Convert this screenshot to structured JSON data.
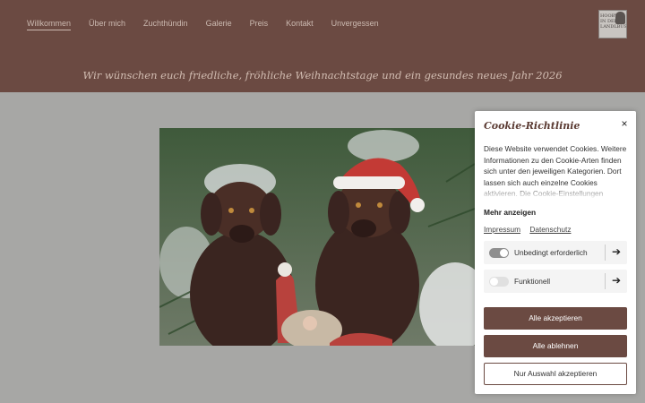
{
  "nav": {
    "items": [
      {
        "label": "Willkommen",
        "active": true
      },
      {
        "label": "Über mich"
      },
      {
        "label": "Zuchthündin"
      },
      {
        "label": "Galerie"
      },
      {
        "label": "Preis"
      },
      {
        "label": "Kontakt"
      },
      {
        "label": "Unvergessen"
      }
    ]
  },
  "logo": {
    "text": "HOOBY IN DER LANDLBUSH",
    "icon": "portrait-logo-icon"
  },
  "tagline": "Wir wünschen euch friedliche, fröhliche Weihnachtstage und ein gesundes neues Jahr 2026",
  "photo": {
    "icon": "two-labradors-christmas-photo"
  },
  "cookie": {
    "title": "Cookie-Richtlinie",
    "close": "×",
    "description": "Diese Website verwendet Cookies. Weitere Informationen zu den Cookie-Arten finden sich unter den jeweiligen Kategorien. Dort lassen sich auch einzelne Cookies aktivieren. Die Cookie-Einstellungen können",
    "more": "Mehr anzeigen",
    "links": {
      "impressum": "Impressum",
      "datenschutz": "Datenschutz"
    },
    "categories": [
      {
        "label": "Unbedingt erforderlich",
        "enabled": true
      },
      {
        "label": "Funktionell",
        "enabled": false
      }
    ],
    "arrow": "➔",
    "buttons": {
      "accept_all": "Alle akzeptieren",
      "reject_all": "Alle ablehnen",
      "accept_selection": "Nur Auswahl akzeptieren"
    }
  },
  "colors": {
    "header": "#6b4a42",
    "accent": "#6b4a42",
    "toggle_on": "#8f8f8f",
    "toggle_off": "#e0e0e0"
  }
}
